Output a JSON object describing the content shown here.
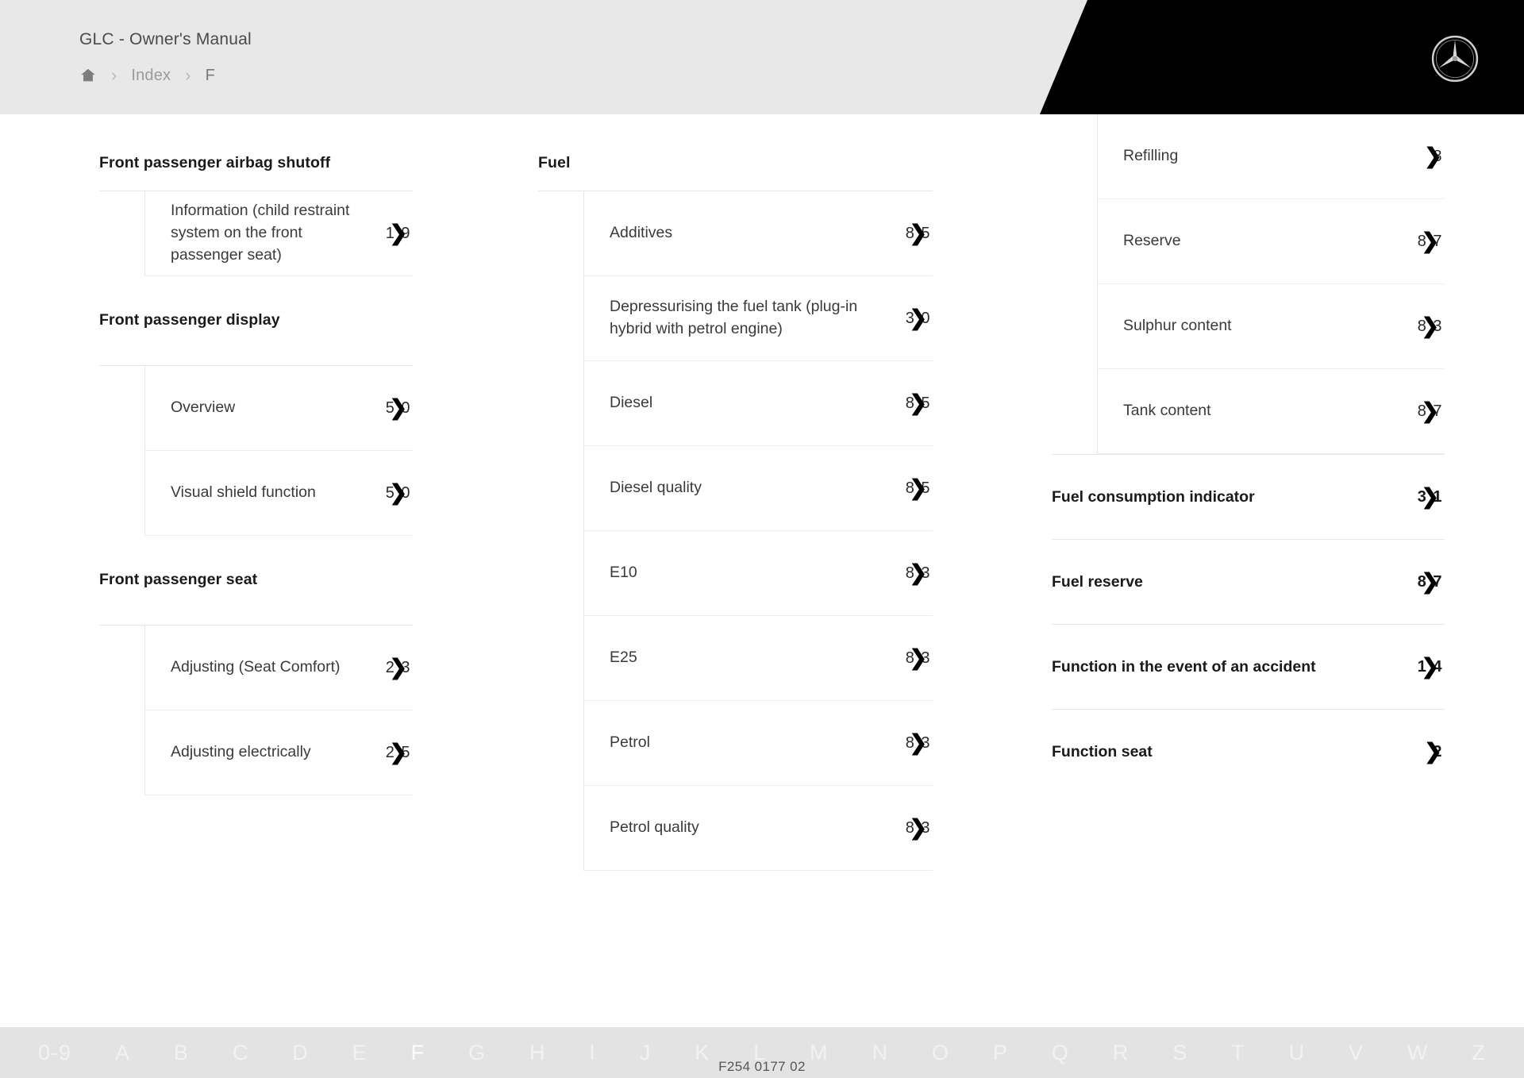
{
  "header": {
    "title": "GLC - Owner's Manual",
    "breadcrumb": {
      "home_icon": "home-icon",
      "separator": "›",
      "items": [
        "Index",
        "F"
      ]
    },
    "logo": "mercedes-benz-star-logo",
    "background": "#e8e8e8",
    "panel_color": "#000000"
  },
  "columns": [
    {
      "blocks": [
        {
          "kind": "group",
          "heading": "Front passenger airbag shutoff",
          "entries": [
            {
              "label": "Information (child restraint system on the front passenger seat)",
              "page": "1 9",
              "chevron": "❯"
            }
          ]
        },
        {
          "kind": "group",
          "heading": "Front passenger display",
          "entries": [
            {
              "label": "Overview",
              "page": "5 0",
              "chevron": "❯"
            },
            {
              "label": "Visual shield function",
              "page": "5 0",
              "chevron": "❯"
            }
          ]
        },
        {
          "kind": "group",
          "heading": "Front passenger seat",
          "entries": [
            {
              "label": "Adjusting (Seat Comfort)",
              "page": "2 3",
              "chevron": "❯"
            },
            {
              "label": "Adjusting electrically",
              "page": "2 5",
              "chevron": "❯"
            }
          ]
        }
      ]
    },
    {
      "blocks": [
        {
          "kind": "group",
          "heading": "Fuel",
          "entries": [
            {
              "label": "Additives",
              "page": "8 5",
              "chevron": "❯"
            },
            {
              "label": "Depressurising the fuel tank (plug-in hybrid with petrol engine)",
              "page": "3 0",
              "chevron": "❯"
            },
            {
              "label": "Diesel",
              "page": "8 5",
              "chevron": "❯"
            },
            {
              "label": "Diesel quality",
              "page": "8 5",
              "chevron": "❯"
            },
            {
              "label": "E10",
              "page": "8 3",
              "chevron": "❯"
            },
            {
              "label": "E25",
              "page": "8 3",
              "chevron": "❯"
            },
            {
              "label": "Petrol",
              "page": "8 3",
              "chevron": "❯"
            },
            {
              "label": "Petrol quality",
              "page": "8 3",
              "chevron": "❯"
            }
          ]
        }
      ]
    },
    {
      "blocks": [
        {
          "kind": "sub-continued",
          "entries": [
            {
              "label": "Refilling",
              "page": " 8",
              "chevron": "❯",
              "short": true
            },
            {
              "label": "Reserve",
              "page": "8 7",
              "chevron": "❯"
            },
            {
              "label": "Sulphur content",
              "page": "8 3",
              "chevron": "❯"
            },
            {
              "label": "Tank content",
              "page": "8 7",
              "chevron": "❯"
            }
          ]
        },
        {
          "kind": "top",
          "label": "Fuel consumption indicator",
          "page": "3 1",
          "chevron": "❯"
        },
        {
          "kind": "top",
          "label": "Fuel reserve",
          "page": "8 7",
          "chevron": "❯"
        },
        {
          "kind": "top",
          "label": "Function in the event of an accident",
          "page": "1 4",
          "chevron": "❯"
        },
        {
          "kind": "top",
          "label": "Function seat",
          "page": " 2",
          "chevron": "❯",
          "short": true
        }
      ]
    }
  ],
  "footer": {
    "letters": [
      "0-9",
      "A",
      "B",
      "C",
      "D",
      "E",
      "F",
      "G",
      "H",
      "I",
      "J",
      "K",
      "L",
      "M",
      "N",
      "O",
      "P",
      "Q",
      "R",
      "S",
      "T",
      "U",
      "V",
      "W",
      "Z"
    ],
    "active_letter": "F",
    "document_code": "F254 0177 02",
    "background": "#e3e3e3"
  }
}
